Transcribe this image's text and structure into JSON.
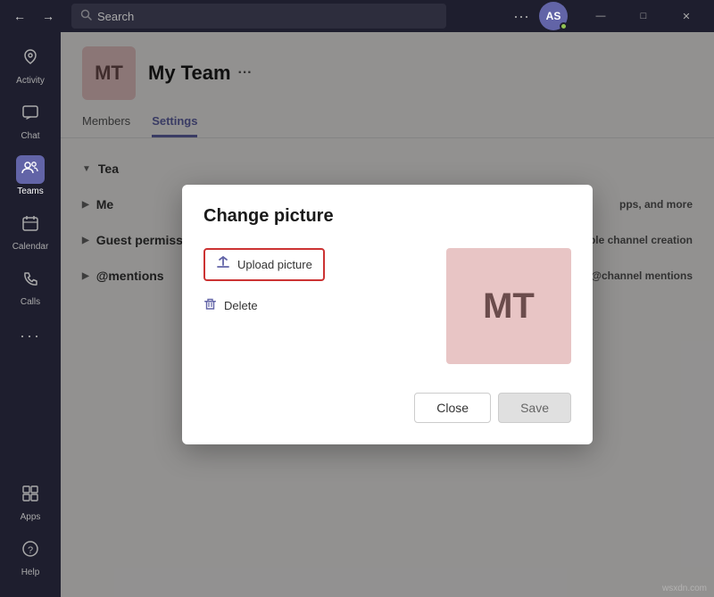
{
  "titlebar": {
    "back_label": "←",
    "forward_label": "→",
    "search_placeholder": "Search",
    "dots_label": "···",
    "avatar_initials": "AS",
    "minimize_label": "—",
    "maximize_label": "□",
    "close_label": "✕"
  },
  "sidebar": {
    "items": [
      {
        "id": "activity",
        "label": "Activity",
        "icon": "🔔"
      },
      {
        "id": "chat",
        "label": "Chat",
        "icon": "💬"
      },
      {
        "id": "teams",
        "label": "Teams",
        "icon": "👥"
      },
      {
        "id": "calendar",
        "label": "Calendar",
        "icon": "📅"
      },
      {
        "id": "calls",
        "label": "Calls",
        "icon": "📞"
      },
      {
        "id": "more",
        "label": "···",
        "icon": "···"
      }
    ],
    "bottom_items": [
      {
        "id": "apps",
        "label": "Apps",
        "icon": "⊞"
      },
      {
        "id": "help",
        "label": "Help",
        "icon": "?"
      }
    ]
  },
  "team": {
    "avatar_text": "MT",
    "name": "My Team",
    "more_label": "···"
  },
  "settings_tabs": [
    {
      "id": "members",
      "label": "Members"
    },
    {
      "id": "settings",
      "label": "Settings"
    }
  ],
  "settings_sections": [
    {
      "id": "team-picture",
      "label": "Tea",
      "expanded": true
    },
    {
      "id": "member-permissions",
      "label": "Me",
      "description": "pps, and more",
      "expanded": false
    },
    {
      "id": "guest-permissions",
      "label": "Guest permissions",
      "description": "Enable channel creation",
      "expanded": false
    },
    {
      "id": "mentions",
      "label": "@mentions",
      "description": "Choose who can use @team and @channel mentions",
      "expanded": false
    }
  ],
  "modal": {
    "title": "Change picture",
    "upload_label": "Upload picture",
    "delete_label": "Delete",
    "preview_text": "MT",
    "close_label": "Close",
    "save_label": "Save"
  },
  "watermark": "wsxdn.com"
}
